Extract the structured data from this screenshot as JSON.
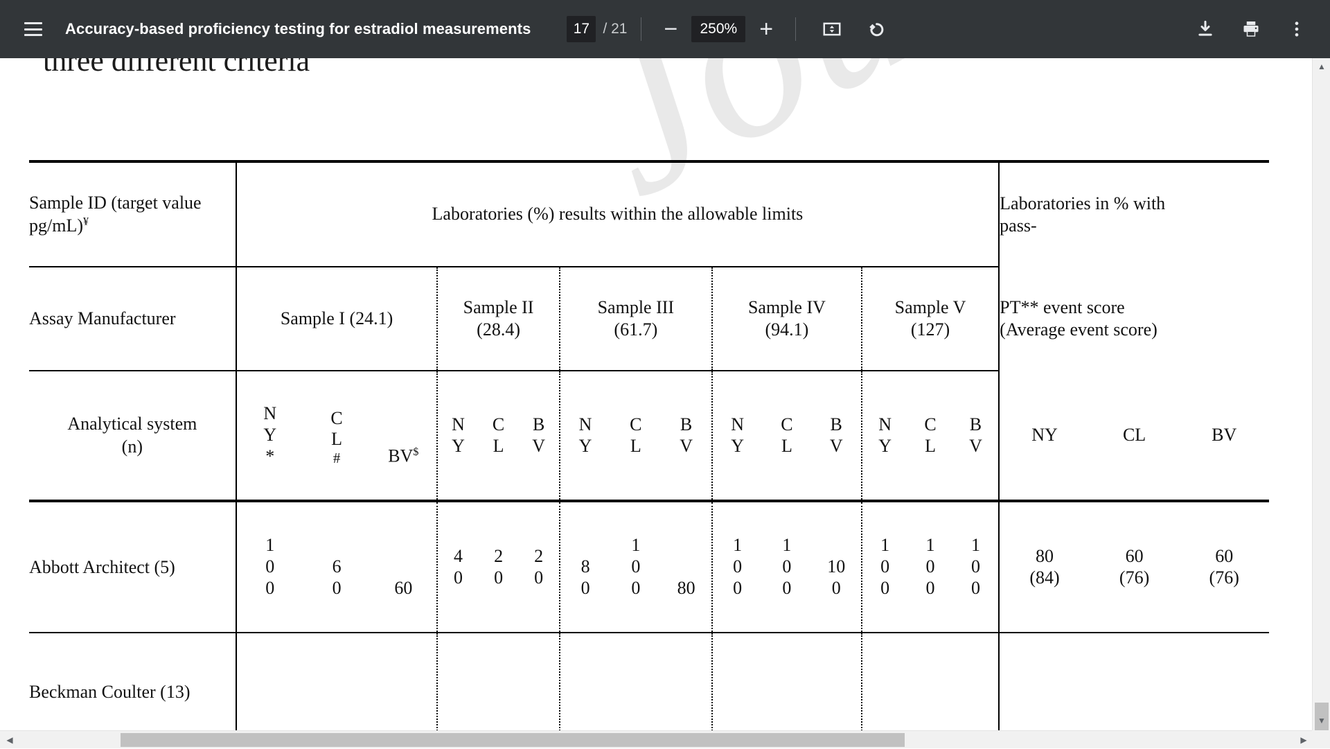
{
  "toolbar": {
    "menu_icon": "hamburger-menu-icon",
    "document_title": "Accuracy-based proficiency testing for estradiol measurements",
    "page_current": "17",
    "page_total": "/ 21",
    "zoom_out_label": "−",
    "zoom_value": "250%",
    "zoom_in_label": "+",
    "fit_icon": "fit-to-page-icon",
    "rotate_icon": "rotate-counterclockwise-icon",
    "download_icon": "download-icon",
    "print_icon": "print-icon",
    "more_icon": "more-options-icon",
    "background_color": "#323639",
    "accent_color": "#202124"
  },
  "document": {
    "clipped_heading": "three different criteria",
    "watermark_text": "Journal Pre-proof"
  },
  "table": {
    "header_row1": {
      "col1_line1": "Sample ID (target value",
      "col1_line2": "pg/mL)",
      "col1_sup": "¥",
      "center_span": "Laboratories (%) results within the allowable limits",
      "right_line1": "Laboratories in % with",
      "right_line2": "pass-"
    },
    "header_row2": {
      "row_label": "Assay Manufacturer",
      "samples": [
        {
          "name": "Sample I (24.1)",
          "two_line": false
        },
        {
          "name_line1": "Sample II",
          "name_line2": "(28.4)",
          "two_line": true
        },
        {
          "name_line1": "Sample III",
          "name_line2": "(61.7)",
          "two_line": true
        },
        {
          "name_line1": "Sample IV",
          "name_line2": "(94.1)",
          "two_line": true
        },
        {
          "name_line1": "Sample V",
          "name_line2": "(127)",
          "two_line": true
        }
      ],
      "right_line1": "PT** event score",
      "right_line2": "(Average event score)"
    },
    "header_row3": {
      "row_label_line1": "Analytical system",
      "row_label_line2": "(n)",
      "sample1_criteria": [
        {
          "l1": "N",
          "l2": "Y",
          "l3": "*"
        },
        {
          "l1": "C",
          "l2": "L",
          "l3": "#"
        },
        {
          "l1": "BV",
          "sup": "$"
        }
      ],
      "criteria_stacked": [
        {
          "l1": "N",
          "l2": "Y"
        },
        {
          "l1": "C",
          "l2": "L"
        },
        {
          "l1": "B",
          "l2": "V"
        }
      ],
      "criteria_inline": [
        "NY",
        "CL",
        "BV"
      ]
    },
    "rows": [
      {
        "manufacturer": "Abbott Architect (5)",
        "sample1": [
          {
            "l1": "1",
            "l2": "0",
            "l3": "0"
          },
          {
            "l1": "",
            "l2": "6",
            "l3": "0"
          },
          {
            "l1": "",
            "l2": "",
            "l3": "60"
          }
        ],
        "sample2": [
          {
            "l1": "4",
            "l2": "0"
          },
          {
            "l1": "2",
            "l2": "0"
          },
          {
            "l1": "2",
            "l2": "0"
          }
        ],
        "sample3": [
          {
            "l1": "8",
            "l2": "0"
          },
          {
            "l1": "1",
            "l2": "0",
            "l3": "0"
          },
          {
            "l1": "",
            "l2": "80"
          }
        ],
        "sample4": [
          {
            "l1": "1",
            "l2": "0",
            "l3": "0"
          },
          {
            "l1": "1",
            "l2": "0",
            "l3": "0"
          },
          {
            "l1": "",
            "l2": "10",
            "l3": "0"
          }
        ],
        "sample5": [
          {
            "l1": "1",
            "l2": "0",
            "l3": "0"
          },
          {
            "l1": "1",
            "l2": "0",
            "l3": "0"
          },
          {
            "l1": "1",
            "l2": "0",
            "l3": "0"
          }
        ],
        "pt_scores": [
          {
            "score": "80",
            "avg": "(84)"
          },
          {
            "score": "60",
            "avg": "(76)"
          },
          {
            "score": "60",
            "avg": "(76)"
          }
        ]
      },
      {
        "manufacturer": "Beckman Coulter (13)",
        "sample1": [],
        "sample2": [],
        "sample3": [],
        "sample4": [],
        "sample5": [],
        "pt_scores": []
      }
    ]
  },
  "scrollbars": {
    "h_left_arrow": "◀",
    "h_right_arrow": "▶",
    "v_up_arrow": "▲",
    "v_down_arrow": "▼"
  }
}
